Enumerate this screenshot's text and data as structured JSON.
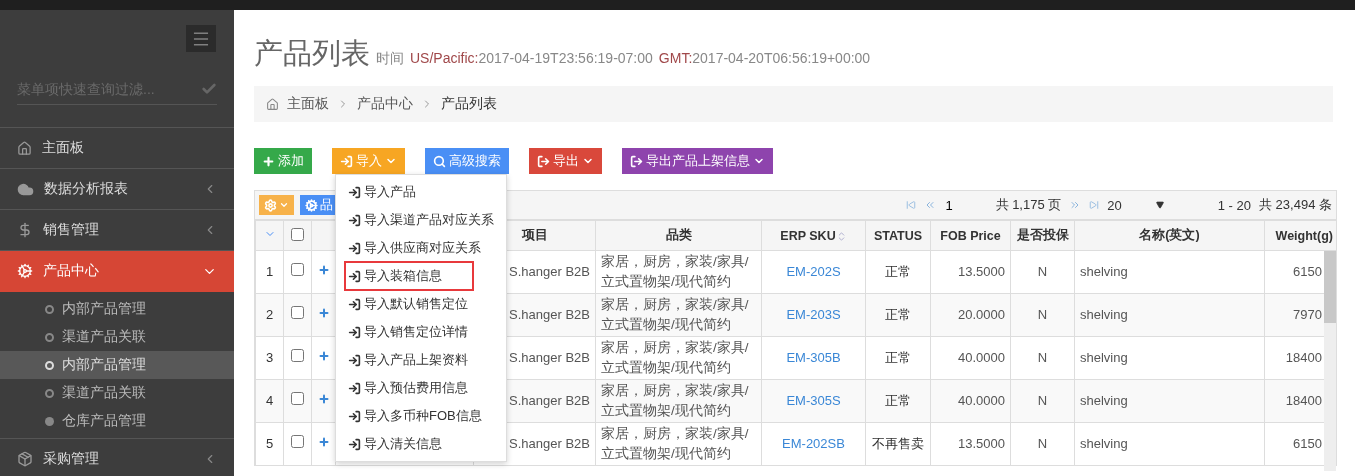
{
  "sidebar": {
    "filter_placeholder": "菜单项快速查询过滤...",
    "items": [
      {
        "label": "主面板",
        "kind": "home",
        "expandable": false,
        "expanded": false,
        "selected": false
      },
      {
        "label": "数据分析报表",
        "kind": "cloud",
        "expandable": true,
        "expanded": false,
        "selected": false
      },
      {
        "label": "销售管理",
        "kind": "dollar",
        "expandable": true,
        "expanded": false,
        "selected": false
      },
      {
        "label": "产品中心",
        "kind": "gears",
        "expanded": true,
        "selected": true,
        "children": [
          {
            "label": "内部产品管理",
            "kind": "ring",
            "selected": false
          },
          {
            "label": "渠道产品关联",
            "kind": "ring",
            "selected": false
          },
          {
            "label": "内部产品管理",
            "kind": "ring",
            "selected": true
          },
          {
            "label": "渠道产品关联",
            "kind": "ring",
            "selected": false
          },
          {
            "label": "仓库产品管理",
            "kind": "dot",
            "selected": false
          }
        ]
      },
      {
        "label": "采购管理",
        "kind": "box",
        "expandable": true,
        "expanded": false,
        "selected": false
      }
    ]
  },
  "page": {
    "title": "产品列表",
    "time_label": "时间",
    "tz1": "US/Pacific:",
    "time1": "2017-04-19T23:56:19-07:00",
    "tz2": "GMT:",
    "time2": "2017-04-20T06:56:19+00:00"
  },
  "breadcrumb": [
    "主面板",
    "产品中心",
    "产品列表"
  ],
  "toolbar": [
    {
      "label": "添加",
      "kind": "add",
      "caret": false
    },
    {
      "label": "导入",
      "kind": "import",
      "caret": true
    },
    {
      "label": "高级搜索",
      "kind": "search",
      "caret": false
    },
    {
      "label": "导出",
      "kind": "export",
      "caret": true
    },
    {
      "label": "导出产品上架信息",
      "kind": "export2",
      "caret": true
    }
  ],
  "import_menu": [
    {
      "label": "导入产品",
      "highlighted": false
    },
    {
      "label": "导入渠道产品对应关系",
      "highlighted": false
    },
    {
      "label": "导入供应商对应关系",
      "highlighted": false
    },
    {
      "label": "导入装箱信息",
      "highlighted": true
    },
    {
      "label": "导入默认销售定位",
      "highlighted": false
    },
    {
      "label": "导入销售定位详情",
      "highlighted": false
    },
    {
      "label": "导入产品上架资料",
      "highlighted": false
    },
    {
      "label": "导入预估费用信息",
      "highlighted": false
    },
    {
      "label": "导入多币种FOB信息",
      "highlighted": false
    },
    {
      "label": "导入清关信息",
      "highlighted": false
    }
  ],
  "grid_toolbar": {
    "category_button": "品",
    "page": "1",
    "page_total": "共 1,175 页",
    "page_size": "20",
    "range": "1 - 20",
    "total": "共 23,494 条"
  },
  "table": {
    "all_checked": false,
    "columns": [
      {
        "label": "项目",
        "sortable": false
      },
      {
        "label": "品类",
        "sortable": false
      },
      {
        "label": "ERP SKU",
        "sortable": true
      },
      {
        "label": "STATUS",
        "sortable": false
      },
      {
        "label": "FOB Price",
        "sortable": false
      },
      {
        "label": "是否投保",
        "sortable": false
      },
      {
        "label": "名称(英文)",
        "sortable": false
      },
      {
        "label": "Weight(g)",
        "sortable": false
      }
    ],
    "rows": [
      {
        "num": "1",
        "checked": false,
        "cells": [
          "S.hanger B2B",
          "家居，厨房，家装/家具/立式置物架/现代简约",
          "EM-202S",
          "正常",
          "13.5000",
          "N",
          "shelving",
          "6150"
        ]
      },
      {
        "num": "2",
        "checked": false,
        "cells": [
          "S.hanger B2B",
          "家居，厨房，家装/家具/立式置物架/现代简约",
          "EM-203S",
          "正常",
          "20.0000",
          "N",
          "shelving",
          "7970"
        ]
      },
      {
        "num": "3",
        "checked": false,
        "cells": [
          "S.hanger B2B",
          "家居，厨房，家装/家具/立式置物架/现代简约",
          "EM-305B",
          "正常",
          "40.0000",
          "N",
          "shelving",
          "18400"
        ]
      },
      {
        "num": "4",
        "checked": false,
        "cells": [
          "S.hanger B2B",
          "家居，厨房，家装/家具/立式置物架/现代简约",
          "EM-305S",
          "正常",
          "40.0000",
          "N",
          "shelving",
          "18400"
        ]
      },
      {
        "num": "5",
        "checked": false,
        "cells": [
          "S.hanger B2B",
          "家居，厨房，家装/家具/立式置物架/现代简约",
          "EM-202SB",
          "不再售卖",
          "13.5000",
          "N",
          "shelving",
          "6150"
        ]
      }
    ]
  }
}
